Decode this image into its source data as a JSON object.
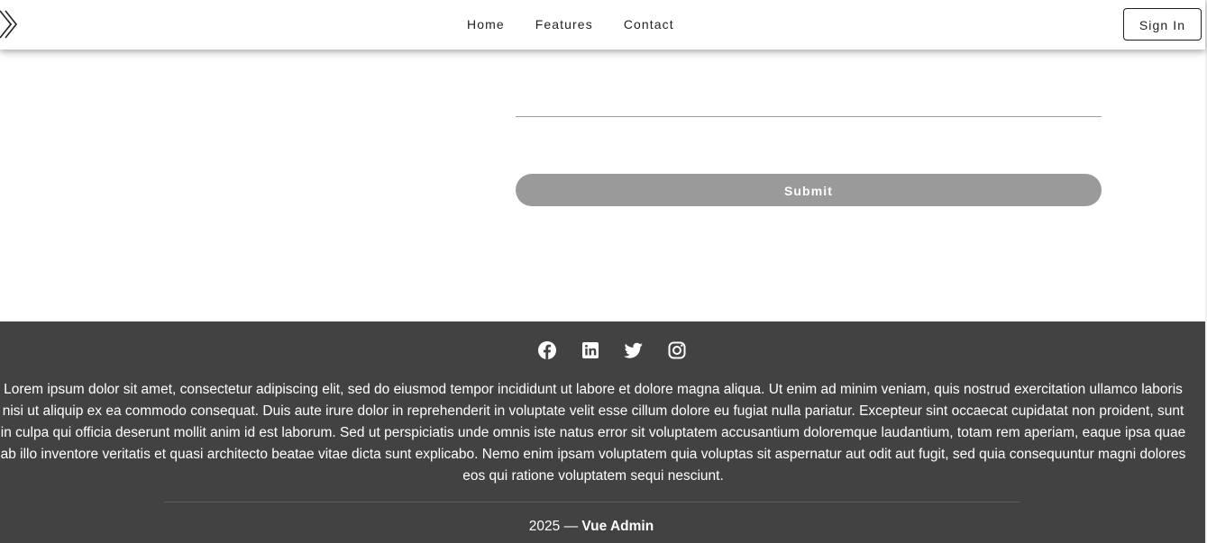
{
  "header": {
    "nav": [
      {
        "label": "Home"
      },
      {
        "label": "Features"
      },
      {
        "label": "Contact"
      }
    ],
    "sign_in_label": "Sign In"
  },
  "form": {
    "submit_label": "Submit"
  },
  "footer": {
    "social_icons": [
      "facebook-icon",
      "linkedin-icon",
      "twitter-icon",
      "instagram-icon"
    ],
    "text": "Lorem ipsum dolor sit amet, consectetur adipiscing elit, sed do eiusmod tempor incididunt ut labore et dolore magna aliqua. Ut enim ad minim veniam, quis nostrud exercitation ullamco laboris nisi ut aliquip ex ea commodo consequat. Duis aute irure dolor in reprehenderit in voluptate velit esse cillum dolore eu fugiat nulla pariatur. Excepteur sint occaecat cupidatat non proident, sunt in culpa qui officia deserunt mollit anim id est laborum. Sed ut perspiciatis unde omnis iste natus error sit voluptatem accusantium doloremque laudantium, totam rem aperiam, eaque ipsa quae ab illo inventore veritatis et quasi architecto beatae vitae dicta sunt explicabo. Nemo enim ipsam voluptatem quia voluptas sit aspernatur aut odit aut fugit, sed quia consequuntur magni dolores eos qui ratione voluptatem sequi nesciunt.",
    "year": "2025",
    "separator": "—",
    "brand": "Vue Admin"
  },
  "colors": {
    "footer_bg": "#424242",
    "submit_bg": "#9a9a9a",
    "header_bg": "#ffffff",
    "text_dark": "#1f1f1f"
  }
}
